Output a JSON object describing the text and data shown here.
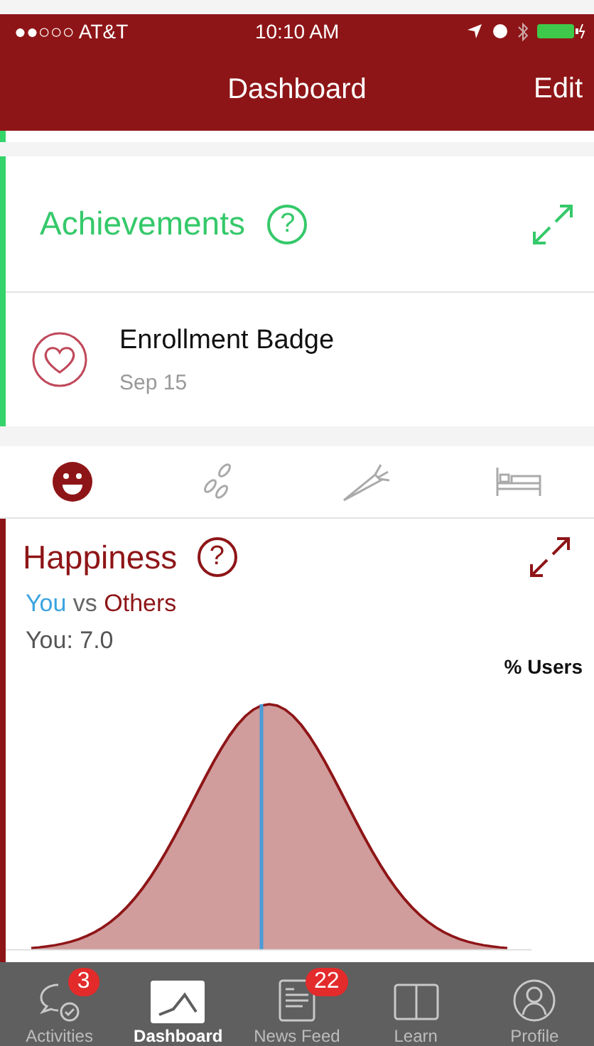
{
  "status_bar": {
    "carrier": "●●○○○ AT&T",
    "time": "10:10 AM"
  },
  "nav": {
    "title": "Dashboard",
    "action": "Edit"
  },
  "achievements": {
    "title": "Achievements",
    "help": "?",
    "badges": [
      {
        "name": "Enrollment Badge",
        "date": "Sep 15"
      }
    ]
  },
  "categories": [
    {
      "kind": "happiness",
      "selected": true
    },
    {
      "kind": "activity",
      "selected": false
    },
    {
      "kind": "nutrition",
      "selected": false
    },
    {
      "kind": "sleep",
      "selected": false
    }
  ],
  "happiness": {
    "title": "Happiness",
    "help": "?",
    "legend_you": "You",
    "legend_vs": "vs",
    "legend_others": "Others",
    "score": "You: 7.0",
    "axis_label": "% Users"
  },
  "tab_bar": [
    {
      "kind": "activities",
      "label": "Activities",
      "badge": "3",
      "selected": false
    },
    {
      "kind": "dashboard",
      "label": "Dashboard",
      "selected": true
    },
    {
      "kind": "news",
      "label": "News Feed",
      "badge": "22",
      "selected": false
    },
    {
      "kind": "learn",
      "label": "Learn",
      "selected": false
    },
    {
      "kind": "profile",
      "label": "Profile",
      "selected": false
    }
  ]
}
